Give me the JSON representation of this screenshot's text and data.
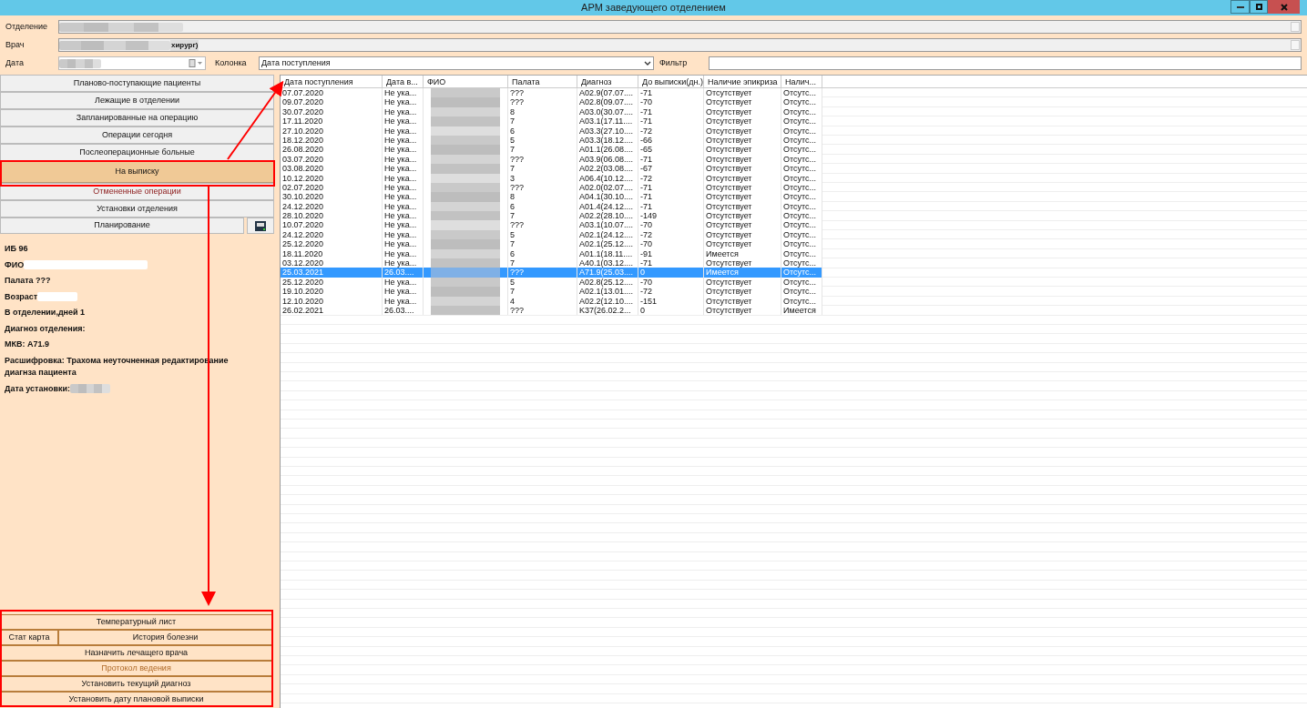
{
  "window": {
    "title": "АРМ заведующего отделением"
  },
  "form": {
    "department_label": "Отделение",
    "doctor_label": "Врач",
    "doctor_value_visible": "хирург)",
    "date_label": "Дата",
    "column_label": "Колонка",
    "column_value": "Дата поступления",
    "filter_label": "Фильтр"
  },
  "nav": [
    {
      "label": "Планово-поступающие пациенты",
      "selected": false,
      "alert": false
    },
    {
      "label": "Лежащие в отделении",
      "selected": false,
      "alert": false
    },
    {
      "label": "Запланированные на операцию",
      "selected": false,
      "alert": false
    },
    {
      "label": "Операции сегодня",
      "selected": false,
      "alert": false
    },
    {
      "label": "Послеоперационные больные",
      "selected": false,
      "alert": false
    },
    {
      "label": "На выписку",
      "selected": true,
      "alert": false
    },
    {
      "label": "Отмененные операции",
      "selected": false,
      "alert": true
    },
    {
      "label": "Установки отделения",
      "selected": false,
      "alert": false
    }
  ],
  "planning": {
    "label": "Планирование"
  },
  "patient": {
    "lines": [
      {
        "text": "ИБ 96",
        "kind": "plain"
      },
      {
        "text": "ФИО",
        "kind": "name"
      },
      {
        "text": "Палата ???",
        "kind": "plain"
      },
      {
        "text": "Возраст",
        "kind": "age"
      },
      {
        "text": "В отделении,дней 1",
        "kind": "plain"
      },
      {
        "text": "Диагноз отделения:",
        "kind": "plain"
      },
      {
        "text": "МКВ: А71.9",
        "kind": "plain"
      },
      {
        "text": "Расшифровка: Трахома неуточненная редактирование диагнза пациента",
        "kind": "plain"
      },
      {
        "text": "Дата установки: ",
        "kind": "date"
      }
    ]
  },
  "actions": [
    {
      "buttons": [
        {
          "label": "Температурный лист",
          "disabled": false
        }
      ]
    },
    {
      "buttons": [
        {
          "label": "Стат карта",
          "disabled": false
        },
        {
          "label": "История болезни",
          "disabled": false
        }
      ]
    },
    {
      "buttons": [
        {
          "label": "Назначить лечащего врача",
          "disabled": false
        }
      ]
    },
    {
      "buttons": [
        {
          "label": "Протокол ведения",
          "disabled": true
        }
      ]
    },
    {
      "buttons": [
        {
          "label": "Установить текущий диагноз",
          "disabled": false
        }
      ]
    },
    {
      "buttons": [
        {
          "label": "Установить дату плановой выписки",
          "disabled": false
        }
      ]
    }
  ],
  "table": {
    "columns": [
      "Дата поступления",
      "Дата в...",
      "ФИО",
      "Палата",
      "Диагноз",
      "До выписки(дн.)",
      "Наличие эпикриза",
      "Налич..."
    ],
    "rows": [
      {
        "cells": [
          "07.07.2020",
          "Не ука...",
          "",
          "???",
          "A02.9(07.07....",
          "-71",
          "Отсутствует",
          "Отсутс..."
        ],
        "selected": false
      },
      {
        "cells": [
          "09.07.2020",
          "Не ука...",
          "",
          "???",
          "A02.8(09.07....",
          "-70",
          "Отсутствует",
          "Отсутс..."
        ],
        "selected": false
      },
      {
        "cells": [
          "30.07.2020",
          "Не ука...",
          "",
          "8",
          "A03.0(30.07....",
          "-71",
          "Отсутствует",
          "Отсутс..."
        ],
        "selected": false
      },
      {
        "cells": [
          "17.11.2020",
          "Не ука...",
          "",
          "7",
          "A03.1(17.11....",
          "-71",
          "Отсутствует",
          "Отсутс..."
        ],
        "selected": false
      },
      {
        "cells": [
          "27.10.2020",
          "Не ука...",
          "",
          "6",
          "A03.3(27.10....",
          "-72",
          "Отсутствует",
          "Отсутс..."
        ],
        "selected": false
      },
      {
        "cells": [
          "18.12.2020",
          "Не ука...",
          "",
          "5",
          "A03.3(18.12....",
          "-66",
          "Отсутствует",
          "Отсутс..."
        ],
        "selected": false
      },
      {
        "cells": [
          "26.08.2020",
          "Не ука...",
          "",
          "7",
          "A01.1(26.08....",
          "-65",
          "Отсутствует",
          "Отсутс..."
        ],
        "selected": false
      },
      {
        "cells": [
          "03.07.2020",
          "Не ука...",
          "",
          "???",
          "A03.9(06.08....",
          "-71",
          "Отсутствует",
          "Отсутс..."
        ],
        "selected": false
      },
      {
        "cells": [
          "03.08.2020",
          "Не ука...",
          "",
          "7",
          "A02.2(03.08....",
          "-67",
          "Отсутствует",
          "Отсутс..."
        ],
        "selected": false
      },
      {
        "cells": [
          "10.12.2020",
          "Не ука...",
          "",
          "3",
          "A06.4(10.12....",
          "-72",
          "Отсутствует",
          "Отсутс..."
        ],
        "selected": false
      },
      {
        "cells": [
          "02.07.2020",
          "Не ука...",
          "",
          "???",
          "A02.0(02.07....",
          "-71",
          "Отсутствует",
          "Отсутс..."
        ],
        "selected": false
      },
      {
        "cells": [
          "30.10.2020",
          "Не ука...",
          "",
          "8",
          "A04.1(30.10....",
          "-71",
          "Отсутствует",
          "Отсутс..."
        ],
        "selected": false
      },
      {
        "cells": [
          "24.12.2020",
          "Не ука...",
          "",
          "6",
          "A01.4(24.12....",
          "-71",
          "Отсутствует",
          "Отсутс..."
        ],
        "selected": false
      },
      {
        "cells": [
          "28.10.2020",
          "Не ука...",
          "",
          "7",
          "A02.2(28.10....",
          "-149",
          "Отсутствует",
          "Отсутс..."
        ],
        "selected": false
      },
      {
        "cells": [
          "10.07.2020",
          "Не ука...",
          "",
          "???",
          "A03.1(10.07....",
          "-70",
          "Отсутствует",
          "Отсутс..."
        ],
        "selected": false
      },
      {
        "cells": [
          "24.12.2020",
          "Не ука...",
          "",
          "5",
          "A02.1(24.12....",
          "-72",
          "Отсутствует",
          "Отсутс..."
        ],
        "selected": false
      },
      {
        "cells": [
          "25.12.2020",
          "Не ука...",
          "",
          "7",
          "A02.1(25.12....",
          "-70",
          "Отсутствует",
          "Отсутс..."
        ],
        "selected": false
      },
      {
        "cells": [
          "18.11.2020",
          "Не ука...",
          "",
          "6",
          "A01.1(18.11....",
          "-91",
          "Имеется",
          "Отсутс..."
        ],
        "selected": false
      },
      {
        "cells": [
          "03.12.2020",
          "Не ука...",
          "",
          "7",
          "A40.1(03.12....",
          "-71",
          "Отсутствует",
          "Отсутс..."
        ],
        "selected": false
      },
      {
        "cells": [
          "25.03.2021",
          "26.03....",
          "",
          "???",
          "A71.9(25.03....",
          "0",
          "Имеется",
          "Отсутс..."
        ],
        "selected": true
      },
      {
        "cells": [
          "25.12.2020",
          "Не ука...",
          "",
          "5",
          "A02.8(25.12....",
          "-70",
          "Отсутствует",
          "Отсутс..."
        ],
        "selected": false
      },
      {
        "cells": [
          "19.10.2020",
          "Не ука...",
          "",
          "7",
          "A02.1(13.01....",
          "-72",
          "Отсутствует",
          "Отсутс..."
        ],
        "selected": false
      },
      {
        "cells": [
          "12.10.2020",
          "Не ука...",
          "",
          "4",
          "A02.2(12.10....",
          "-151",
          "Отсутствует",
          "Отсутс..."
        ],
        "selected": false
      },
      {
        "cells": [
          "26.02.2021",
          "26.03....",
          "",
          "???",
          "K37(26.02.2...",
          "0",
          "Отсутствует",
          "Имеется"
        ],
        "selected": false
      }
    ]
  }
}
